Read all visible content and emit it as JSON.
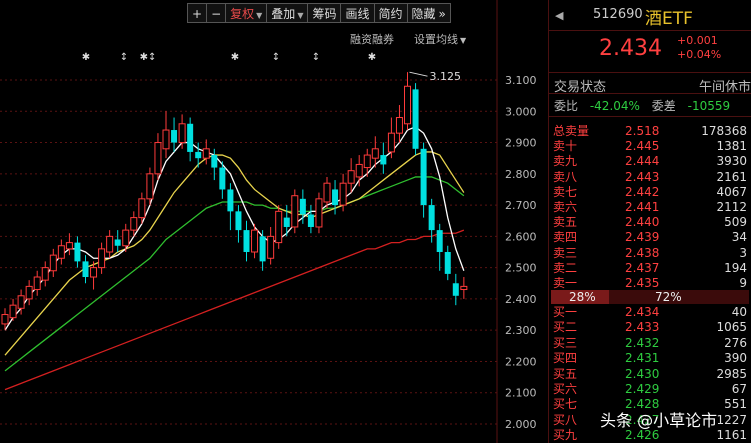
{
  "toolbar": {
    "plus": "+",
    "minus": "−",
    "fuquan": "复权",
    "diejia": "叠加",
    "chouma": "筹码",
    "huaxian": "画线",
    "jieyue": "简约",
    "yincang": "隐藏",
    "more": "»"
  },
  "subbar": {
    "rongzi": "融资融券",
    "junxian": "设置均线"
  },
  "y_ticks": [
    "3.100",
    "3.000",
    "2.900",
    "2.800",
    "2.700",
    "2.600",
    "2.500",
    "2.400",
    "2.300",
    "2.200",
    "2.100",
    "2.000"
  ],
  "peak_label": "3.125",
  "markers": [
    "✱",
    "↕",
    "✱↕",
    "✱",
    "↕",
    "↕",
    "✱"
  ],
  "stock": {
    "code": "512690",
    "name": "酒ETF",
    "price": "2.434",
    "change": "+0.001",
    "change_pct": "+0.04%"
  },
  "status": {
    "label": "交易状态",
    "value": "午间休市"
  },
  "weibi": {
    "label": "委比",
    "value": "-42.04%",
    "label2": "委差",
    "value2": "-10559"
  },
  "asks": [
    {
      "label": "总卖量",
      "price": "2.518",
      "vol": "178368"
    },
    {
      "label": "卖十",
      "price": "2.445",
      "vol": "1381"
    },
    {
      "label": "卖九",
      "price": "2.444",
      "vol": "3930"
    },
    {
      "label": "卖八",
      "price": "2.443",
      "vol": "2161"
    },
    {
      "label": "卖七",
      "price": "2.442",
      "vol": "4067"
    },
    {
      "label": "卖六",
      "price": "2.441",
      "vol": "2112"
    },
    {
      "label": "卖五",
      "price": "2.440",
      "vol": "509"
    },
    {
      "label": "卖四",
      "price": "2.439",
      "vol": "34"
    },
    {
      "label": "卖三",
      "price": "2.438",
      "vol": "3"
    },
    {
      "label": "卖二",
      "price": "2.437",
      "vol": "194"
    },
    {
      "label": "卖一",
      "price": "2.435",
      "vol": "9"
    }
  ],
  "ratio": {
    "left": "28%",
    "right": "72%"
  },
  "bids": [
    {
      "label": "买一",
      "price": "2.434",
      "vol": "40"
    },
    {
      "label": "买二",
      "price": "2.433",
      "vol": "1065"
    },
    {
      "label": "买三",
      "price": "2.432",
      "vol": "276"
    },
    {
      "label": "买四",
      "price": "2.431",
      "vol": "390"
    },
    {
      "label": "买五",
      "price": "2.430",
      "vol": "2985"
    },
    {
      "label": "买六",
      "price": "2.429",
      "vol": "67"
    },
    {
      "label": "买七",
      "price": "2.428",
      "vol": "551"
    },
    {
      "label": "买八",
      "price": "2.427",
      "vol": "1227"
    },
    {
      "label": "买九",
      "price": "2.426",
      "vol": "1161"
    }
  ],
  "watermark": "头条 @小草论市",
  "colors": {
    "up": "#ff3b3b",
    "down": "#00e0e0",
    "ma5": "#ffffff",
    "ma10": "#e8d44d",
    "ma20": "#2fbf2f",
    "ma60": "#d42020"
  },
  "chart_data": {
    "type": "candlestick",
    "ylim": [
      2.0,
      3.15
    ],
    "candles": [
      [
        2.32,
        2.35,
        2.3,
        2.37
      ],
      [
        2.34,
        2.38,
        2.33,
        2.4
      ],
      [
        2.37,
        2.41,
        2.35,
        2.43
      ],
      [
        2.4,
        2.44,
        2.38,
        2.46
      ],
      [
        2.43,
        2.47,
        2.41,
        2.49
      ],
      [
        2.46,
        2.5,
        2.44,
        2.52
      ],
      [
        2.49,
        2.54,
        2.47,
        2.56
      ],
      [
        2.53,
        2.57,
        2.51,
        2.59
      ],
      [
        2.56,
        2.58,
        2.54,
        2.61
      ],
      [
        2.58,
        2.52,
        2.5,
        2.6
      ],
      [
        2.52,
        2.47,
        2.45,
        2.54
      ],
      [
        2.47,
        2.5,
        2.43,
        2.52
      ],
      [
        2.5,
        2.56,
        2.48,
        2.58
      ],
      [
        2.55,
        2.6,
        2.53,
        2.62
      ],
      [
        2.59,
        2.57,
        2.55,
        2.62
      ],
      [
        2.57,
        2.62,
        2.55,
        2.64
      ],
      [
        2.62,
        2.66,
        2.6,
        2.68
      ],
      [
        2.66,
        2.72,
        2.64,
        2.74
      ],
      [
        2.72,
        2.8,
        2.7,
        2.82
      ],
      [
        2.8,
        2.9,
        2.78,
        2.93
      ],
      [
        2.88,
        2.94,
        2.85,
        3.0
      ],
      [
        2.94,
        2.9,
        2.87,
        2.98
      ],
      [
        2.9,
        2.96,
        2.88,
        2.99
      ],
      [
        2.96,
        2.87,
        2.84,
        2.98
      ],
      [
        2.87,
        2.85,
        2.82,
        2.9
      ],
      [
        2.85,
        2.88,
        2.83,
        2.91
      ],
      [
        2.86,
        2.82,
        2.78,
        2.88
      ],
      [
        2.82,
        2.75,
        2.72,
        2.84
      ],
      [
        2.75,
        2.68,
        2.62,
        2.77
      ],
      [
        2.68,
        2.62,
        2.58,
        2.7
      ],
      [
        2.62,
        2.55,
        2.52,
        2.65
      ],
      [
        2.55,
        2.62,
        2.53,
        2.64
      ],
      [
        2.6,
        2.52,
        2.49,
        2.62
      ],
      [
        2.53,
        2.6,
        2.51,
        2.63
      ],
      [
        2.58,
        2.68,
        2.56,
        2.7
      ],
      [
        2.66,
        2.63,
        2.6,
        2.7
      ],
      [
        2.63,
        2.73,
        2.61,
        2.75
      ],
      [
        2.72,
        2.67,
        2.64,
        2.75
      ],
      [
        2.67,
        2.63,
        2.61,
        2.7
      ],
      [
        2.63,
        2.72,
        2.61,
        2.74
      ],
      [
        2.71,
        2.77,
        2.69,
        2.79
      ],
      [
        2.75,
        2.7,
        2.67,
        2.78
      ],
      [
        2.7,
        2.77,
        2.68,
        2.8
      ],
      [
        2.77,
        2.81,
        2.74,
        2.85
      ],
      [
        2.79,
        2.83,
        2.76,
        2.86
      ],
      [
        2.82,
        2.86,
        2.79,
        2.88
      ],
      [
        2.85,
        2.88,
        2.82,
        2.92
      ],
      [
        2.86,
        2.83,
        2.8,
        2.9
      ],
      [
        2.87,
        2.93,
        2.85,
        2.98
      ],
      [
        2.93,
        2.98,
        2.9,
        3.02
      ],
      [
        2.96,
        3.08,
        2.94,
        3.125
      ],
      [
        3.07,
        2.88,
        2.86,
        3.09
      ],
      [
        2.88,
        2.7,
        2.66,
        2.9
      ],
      [
        2.7,
        2.62,
        2.58,
        2.72
      ],
      [
        2.62,
        2.55,
        2.49,
        2.64
      ],
      [
        2.55,
        2.48,
        2.46,
        2.57
      ],
      [
        2.45,
        2.41,
        2.38,
        2.48
      ],
      [
        2.43,
        2.44,
        2.4,
        2.47
      ]
    ],
    "ma5": [
      2.3,
      2.34,
      2.37,
      2.41,
      2.44,
      2.47,
      2.51,
      2.54,
      2.56,
      2.56,
      2.55,
      2.53,
      2.53,
      2.53,
      2.54,
      2.56,
      2.6,
      2.64,
      2.7,
      2.78,
      2.84,
      2.87,
      2.9,
      2.9,
      2.88,
      2.87,
      2.86,
      2.83,
      2.8,
      2.74,
      2.68,
      2.63,
      2.6,
      2.58,
      2.59,
      2.61,
      2.64,
      2.66,
      2.68,
      2.68,
      2.7,
      2.71,
      2.72,
      2.74,
      2.78,
      2.8,
      2.83,
      2.85,
      2.87,
      2.9,
      2.94,
      2.95,
      2.93,
      2.88,
      2.79,
      2.66,
      2.56,
      2.49
    ],
    "ma10": [
      2.22,
      2.25,
      2.28,
      2.31,
      2.34,
      2.37,
      2.4,
      2.43,
      2.46,
      2.48,
      2.5,
      2.51,
      2.52,
      2.53,
      2.55,
      2.56,
      2.57,
      2.59,
      2.62,
      2.66,
      2.7,
      2.74,
      2.77,
      2.8,
      2.83,
      2.85,
      2.86,
      2.86,
      2.85,
      2.82,
      2.78,
      2.75,
      2.73,
      2.71,
      2.69,
      2.68,
      2.67,
      2.67,
      2.66,
      2.67,
      2.68,
      2.69,
      2.7,
      2.71,
      2.72,
      2.74,
      2.76,
      2.78,
      2.8,
      2.82,
      2.84,
      2.86,
      2.87,
      2.87,
      2.86,
      2.82,
      2.78,
      2.74
    ],
    "ma20": [
      2.17,
      2.19,
      2.21,
      2.23,
      2.25,
      2.27,
      2.29,
      2.31,
      2.33,
      2.35,
      2.37,
      2.39,
      2.41,
      2.43,
      2.45,
      2.47,
      2.49,
      2.51,
      2.53,
      2.56,
      2.59,
      2.61,
      2.63,
      2.65,
      2.67,
      2.69,
      2.7,
      2.71,
      2.71,
      2.71,
      2.71,
      2.7,
      2.7,
      2.69,
      2.69,
      2.68,
      2.68,
      2.68,
      2.68,
      2.68,
      2.69,
      2.69,
      2.7,
      2.71,
      2.72,
      2.73,
      2.74,
      2.75,
      2.76,
      2.77,
      2.78,
      2.79,
      2.79,
      2.79,
      2.78,
      2.77,
      2.75,
      2.73
    ],
    "ma60": [
      2.11,
      2.12,
      2.13,
      2.14,
      2.15,
      2.16,
      2.17,
      2.18,
      2.19,
      2.2,
      2.21,
      2.22,
      2.23,
      2.24,
      2.25,
      2.26,
      2.27,
      2.28,
      2.29,
      2.3,
      2.31,
      2.32,
      2.33,
      2.34,
      2.35,
      2.36,
      2.37,
      2.38,
      2.39,
      2.4,
      2.41,
      2.42,
      2.43,
      2.44,
      2.45,
      2.46,
      2.47,
      2.48,
      2.49,
      2.5,
      2.51,
      2.52,
      2.53,
      2.54,
      2.55,
      2.56,
      2.56,
      2.57,
      2.58,
      2.58,
      2.59,
      2.59,
      2.6,
      2.6,
      2.61,
      2.61,
      2.61,
      2.62
    ]
  }
}
